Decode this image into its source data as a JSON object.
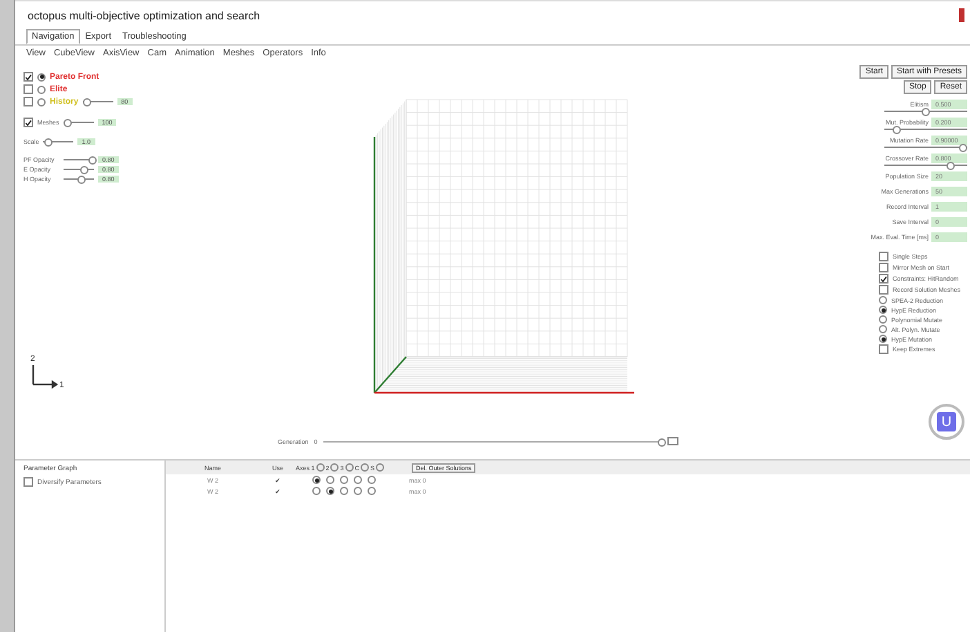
{
  "window": {
    "title": "octopus multi-objective optimization and search"
  },
  "tabs": [
    {
      "label": "Navigation",
      "selected": true
    },
    {
      "label": "Export",
      "selected": false
    },
    {
      "label": "Troubleshooting",
      "selected": false
    }
  ],
  "menu": [
    "View",
    "CubeView",
    "AxisView",
    "Cam",
    "Animation",
    "Meshes",
    "Operators",
    "Info"
  ],
  "layers": [
    {
      "label": "Pareto Front",
      "checked": true,
      "selected": true,
      "color": "#e03030"
    },
    {
      "label": "Elite",
      "checked": false,
      "selected": false,
      "color": "#e03030"
    },
    {
      "label": "History",
      "checked": false,
      "selected": false,
      "color": "#d0c020",
      "level": 0.15,
      "value": "80"
    }
  ],
  "meshes": {
    "label": "Meshes",
    "checked": true,
    "level": 0.15,
    "value": "100"
  },
  "scale": {
    "label": "Scale",
    "level": 0.15,
    "value": "1.0"
  },
  "opacity": [
    {
      "label": "PF Opacity",
      "level": 0.95,
      "value": "0.80"
    },
    {
      "label": "E Opacity",
      "level": 0.7,
      "value": "0.80"
    },
    {
      "label": "H Opacity",
      "level": 0.6,
      "value": "0.80"
    }
  ],
  "buttons": [
    [
      "Start",
      "Start with Presets"
    ],
    [
      "Stop",
      "Reset"
    ]
  ],
  "params": [
    {
      "kind": "slider",
      "label": "Elitism",
      "value": "0.500",
      "level": 0.5
    },
    {
      "kind": "slider",
      "label": "Mut. Probability",
      "value": "0.200",
      "level": 0.15
    },
    {
      "kind": "slider",
      "label": "Mutation Rate",
      "value": "0.90000",
      "level": 0.95
    },
    {
      "kind": "slider",
      "label": "Crossover Rate",
      "value": "0.800",
      "level": 0.8
    },
    {
      "kind": "field",
      "label": "Population Size",
      "value": "20"
    },
    {
      "kind": "field",
      "label": "Max Generations",
      "value": "50"
    },
    {
      "kind": "field",
      "label": "Record Interval",
      "value": "1"
    },
    {
      "kind": "field",
      "label": "Save Interval",
      "value": "0"
    },
    {
      "kind": "field",
      "label": "Max. Eval. Time [ms]",
      "value": "0"
    }
  ],
  "options": [
    {
      "kind": "checkbox",
      "label": "Single Steps",
      "checked": false
    },
    {
      "kind": "checkbox",
      "label": "Mirror Mesh on Start",
      "checked": false
    },
    {
      "kind": "checkbox",
      "label": "Constraints: HitRandom",
      "checked": true
    },
    {
      "kind": "checkbox",
      "label": "Record Solution Meshes",
      "checked": false
    },
    {
      "kind": "radio",
      "label": "SPEA-2 Reduction",
      "selected": false
    },
    {
      "kind": "radio",
      "label": "HypE Reduction",
      "selected": true
    },
    {
      "kind": "radio",
      "label": "Polynomial Mutate",
      "selected": false
    },
    {
      "kind": "radio",
      "label": "Alt. Polyn. Mutate",
      "selected": false
    },
    {
      "kind": "radio",
      "label": "HypE Mutation",
      "selected": true
    },
    {
      "kind": "checkbox",
      "label": "Keep Extremes",
      "checked": false
    }
  ],
  "axis_triad": {
    "vertical": "2",
    "horizontal": "1"
  },
  "generation": {
    "label": "Generation",
    "value": "0",
    "level": 1
  },
  "badge": "U",
  "parameter_graph": {
    "title": "Parameter Graph",
    "option": {
      "label": "Diversify Parameters",
      "checked": false
    }
  },
  "table": {
    "columns": {
      "name": "Name",
      "use": "Use"
    },
    "axes_header": [
      {
        "label": "Axes 1",
        "selected": false
      },
      {
        "label": "2",
        "selected": false
      },
      {
        "label": "3",
        "selected": false
      },
      {
        "label": "C",
        "selected": false
      },
      {
        "label": "S",
        "selected": false
      }
    ],
    "button": "Del. Outer Solutions",
    "rows": [
      {
        "name": "W 2",
        "use": "✔",
        "axes": [
          {
            "selected": true
          },
          {
            "selected": false
          },
          {
            "selected": false
          },
          {
            "selected": false
          },
          {
            "selected": false
          }
        ],
        "extra": "max 0"
      },
      {
        "name": "W 2",
        "use": "✔",
        "axes": [
          {
            "selected": false
          },
          {
            "selected": true
          },
          {
            "selected": false
          },
          {
            "selected": false
          },
          {
            "selected": false
          }
        ],
        "extra": "max 0"
      }
    ]
  }
}
